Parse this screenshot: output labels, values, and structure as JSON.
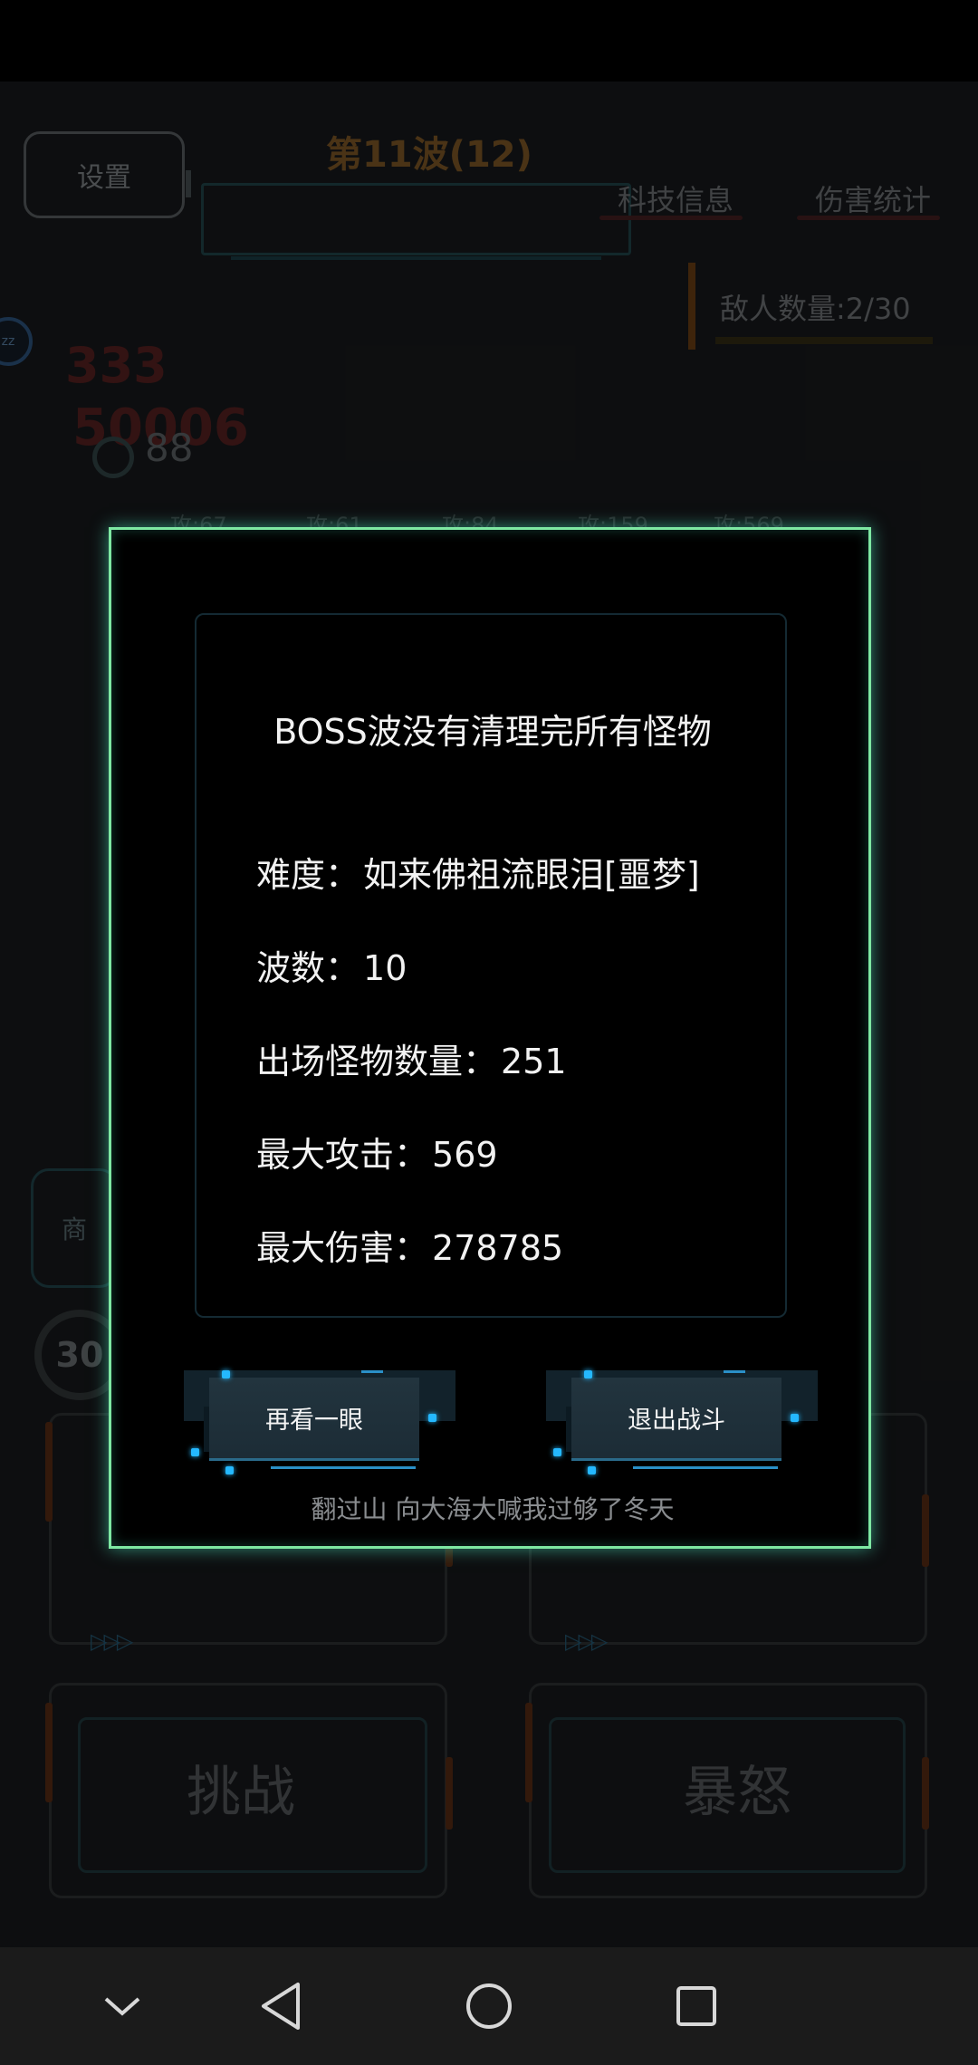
{
  "hud": {
    "settings_label": "设置",
    "wave_title": "第11波(12)",
    "tech_info_label": "科技信息",
    "damage_stats_label": "伤害统计",
    "enemy_count": "敌人数量:2/30",
    "floating_333": "333",
    "floating_50006": "50006",
    "ring_value": "88",
    "attack_labels": [
      "攻:67",
      "攻:61",
      "攻:84",
      "攻:159",
      "攻:569"
    ],
    "shop_label": "商",
    "badge_value": "30",
    "challenge_label": "挑战",
    "fury_label": "暴怒"
  },
  "dialog": {
    "title": "BOSS波没有清理完所有怪物",
    "stats": [
      {
        "label": "难度：",
        "value": "如来佛祖流眼泪[噩梦]"
      },
      {
        "label": "波数：",
        "value": "10"
      },
      {
        "label": "出场怪物数量：",
        "value": "251"
      },
      {
        "label": "最大攻击：",
        "value": "569"
      },
      {
        "label": "最大伤害：",
        "value": "278785"
      }
    ],
    "look_again_label": "再看一眼",
    "exit_battle_label": "退出战斗",
    "footer": "翻过山 向大海大喊我过够了冬天"
  },
  "nav": {
    "icons": [
      "chevron-down-icon",
      "back-icon",
      "home-icon",
      "recents-icon"
    ]
  },
  "colors": {
    "dialog_border": "#7ee8a2",
    "button_accent": "#24b8ff"
  }
}
